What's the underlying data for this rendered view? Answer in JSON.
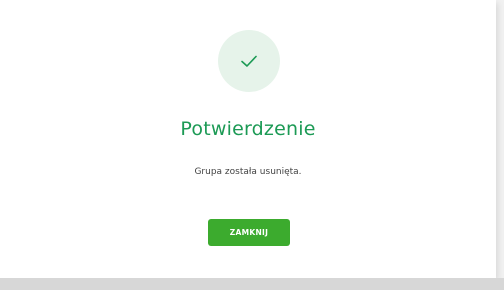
{
  "dialog": {
    "icon": "checkmark-icon",
    "title": "Potwierdzenie",
    "message": "Grupa została usunięta.",
    "close_label": "ZAMKNIJ"
  },
  "colors": {
    "accent": "#1c9a55",
    "button": "#3cab2e",
    "icon_bg": "#e6f3ea"
  }
}
